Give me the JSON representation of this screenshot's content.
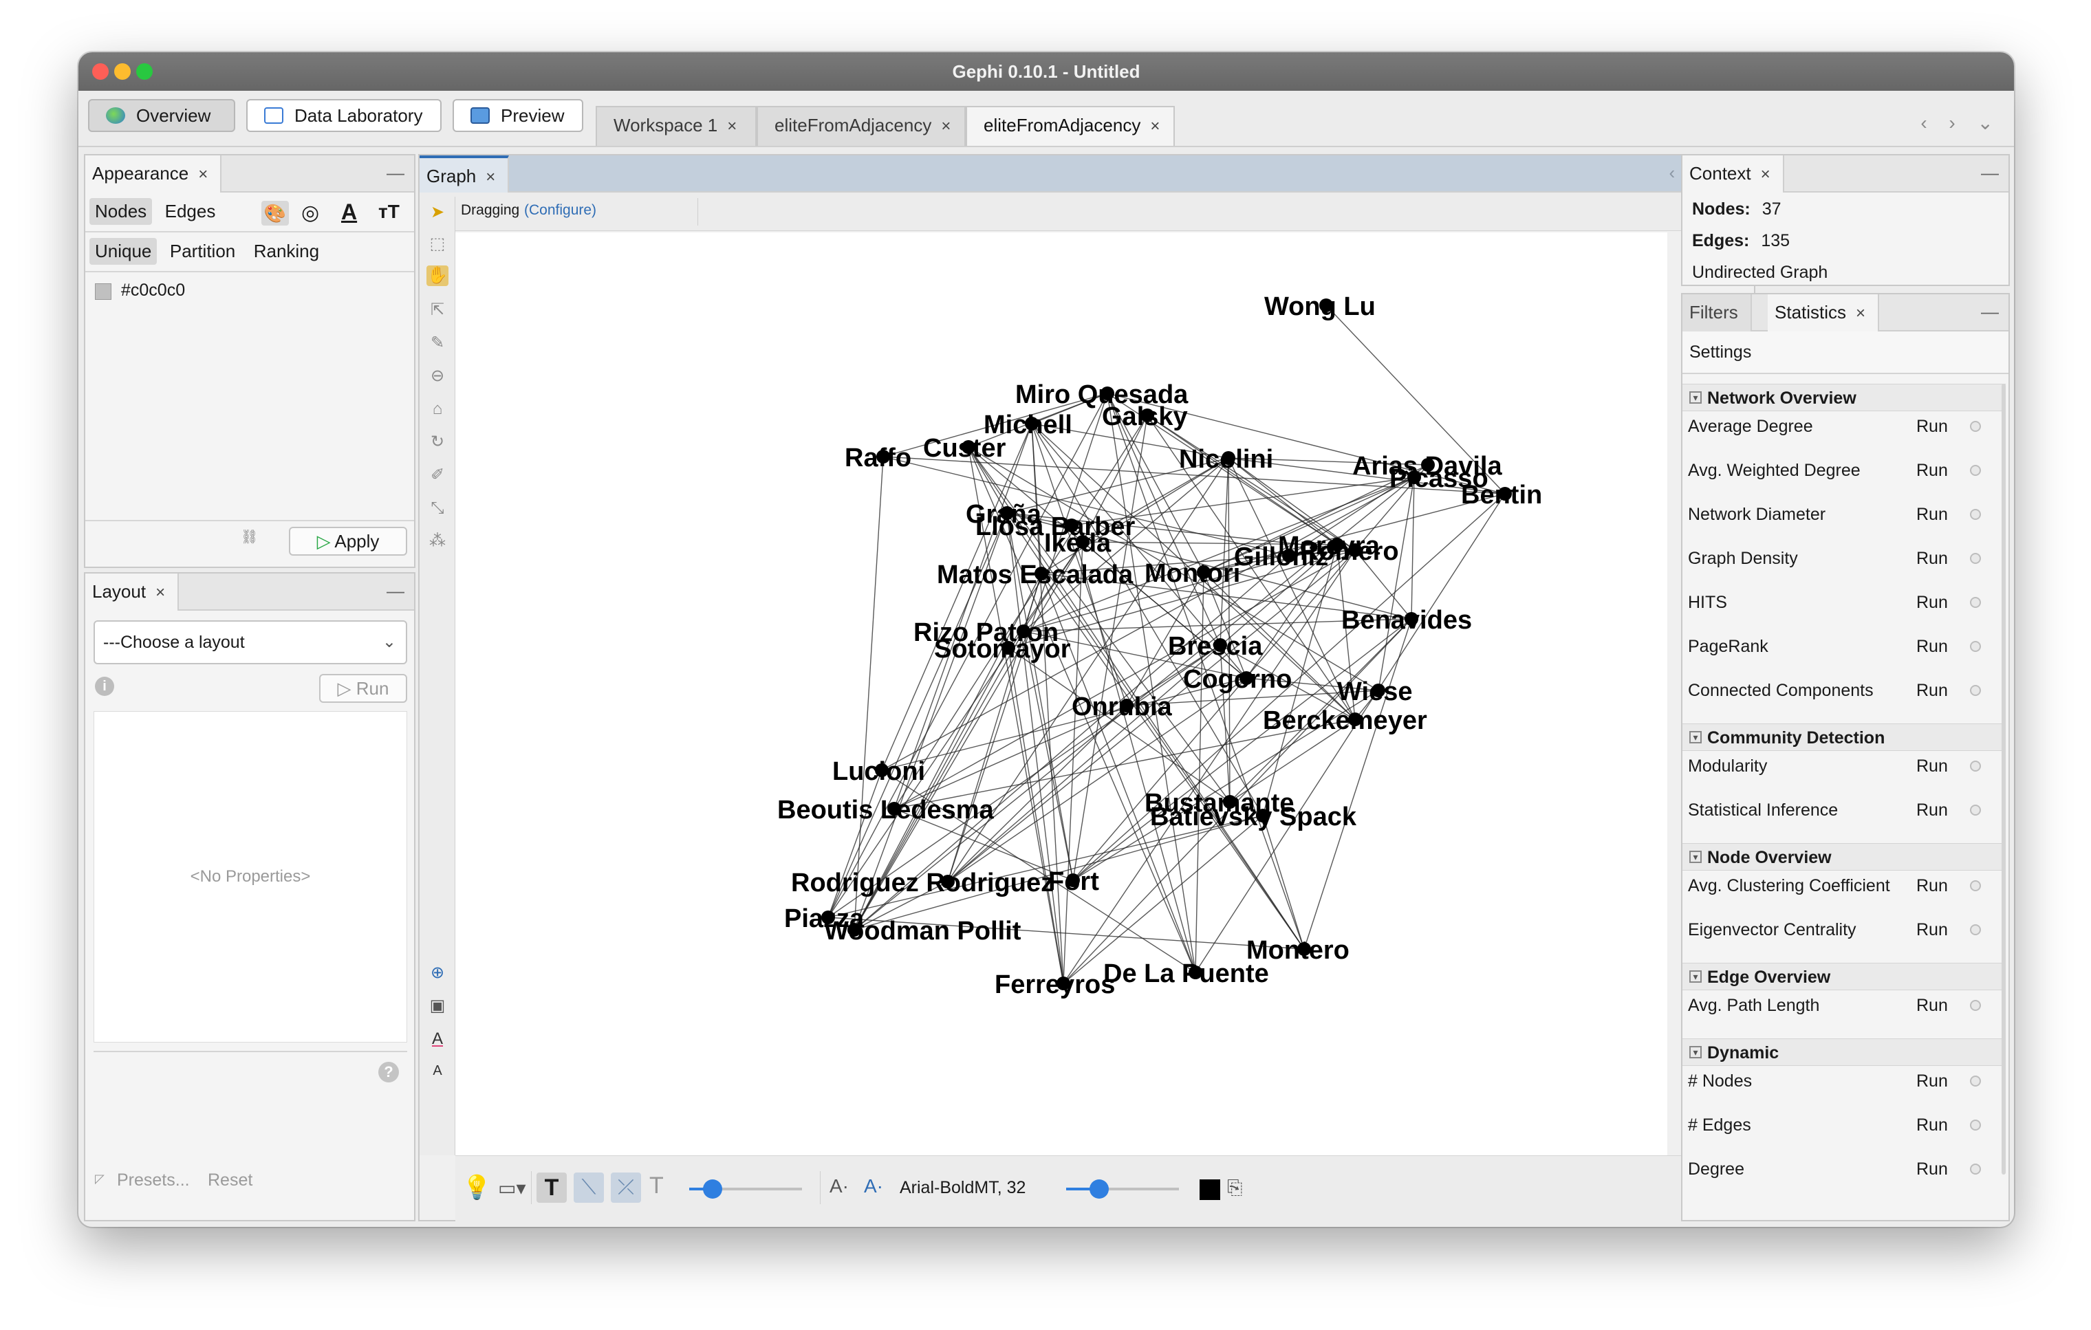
{
  "window": {
    "title": "Gephi 0.10.1 - Untitled"
  },
  "modes": {
    "overview": "Overview",
    "data_lab": "Data Laboratory",
    "preview": "Preview"
  },
  "workspace_tabs": [
    "Workspace 1",
    "eliteFromAdjacency",
    "eliteFromAdjacency"
  ],
  "appearance": {
    "title": "Appearance",
    "nodes": "Nodes",
    "edges": "Edges",
    "unique": "Unique",
    "partition": "Partition",
    "ranking": "Ranking",
    "color_value": "#c0c0c0",
    "apply": "Apply"
  },
  "layout": {
    "title": "Layout",
    "choose": "---Choose a layout",
    "run": "Run",
    "no_props": "<No Properties>",
    "presets": "Presets...",
    "reset": "Reset"
  },
  "graph": {
    "tab": "Graph",
    "mode_label": "Dragging",
    "configure": "(Configure)",
    "font_label": "Arial-BoldMT, 32"
  },
  "context": {
    "title": "Context",
    "nodes_label": "Nodes:",
    "nodes_value": "37",
    "edges_label": "Edges:",
    "edges_value": "135",
    "graph_type": "Undirected Graph"
  },
  "statistics": {
    "filters_tab": "Filters",
    "stats_tab": "Statistics",
    "settings": "Settings",
    "run_label": "Run",
    "sections": [
      {
        "header": "Network Overview",
        "items": [
          "Average Degree",
          "Avg. Weighted Degree",
          "Network Diameter",
          "Graph Density",
          "HITS",
          "PageRank",
          "Connected Components"
        ]
      },
      {
        "header": "Community Detection",
        "items": [
          "Modularity",
          "Statistical Inference"
        ]
      },
      {
        "header": "Node Overview",
        "items": [
          "Avg. Clustering Coefficient",
          "Eigenvector Centrality"
        ]
      },
      {
        "header": "Edge Overview",
        "items": [
          "Avg. Path Length"
        ]
      },
      {
        "header": "Dynamic",
        "items": [
          "# Nodes",
          "# Edges",
          "Degree"
        ]
      }
    ]
  },
  "network": {
    "nodes": [
      "Wong Lu",
      "Miro Quesada",
      "Galsky",
      "Michell",
      "Custer",
      "Raffo",
      "Nicolini",
      "Arias Davila",
      "Picasso",
      "Bentin",
      "Graña",
      "Llosa Barber",
      "Ikeda",
      "Romero",
      "Moreyra",
      "Matos Escalada",
      "Montori",
      "Gilloniz",
      "Benavides",
      "Rizo Patron",
      "Sotomayor",
      "Brescia",
      "Cogorno",
      "Wiese",
      "Onrubia",
      "Berckemeyer",
      "Lucioni",
      "Beoutis Ledesma",
      "Bustamante",
      "Batievsky Spack",
      "Rodriguez Rodriguez",
      "Fort",
      "Piazza",
      "Woodman Pollit",
      "Montero",
      "De La Puente",
      "Ferreyros"
    ]
  }
}
